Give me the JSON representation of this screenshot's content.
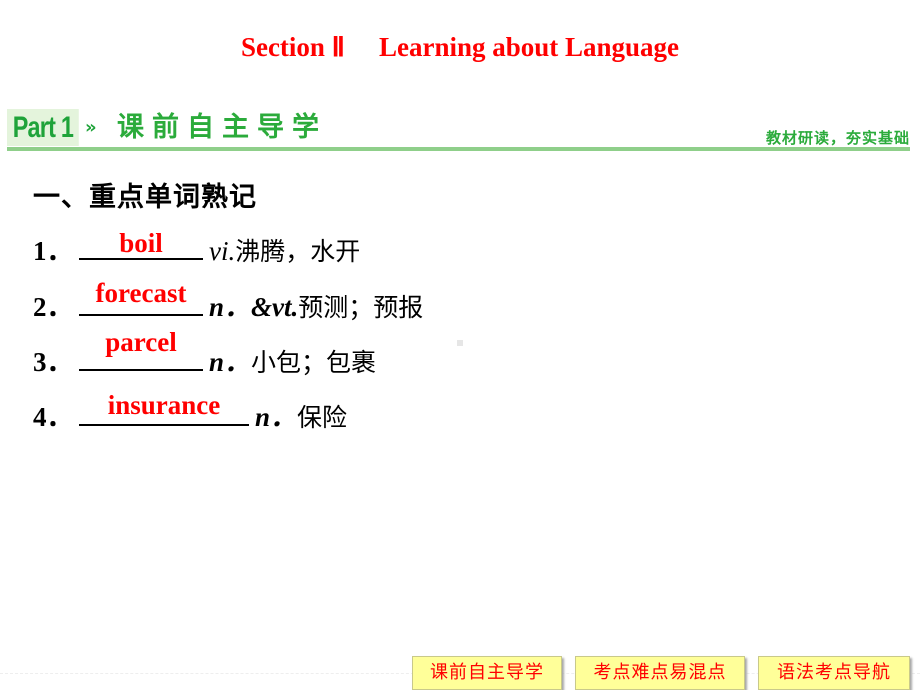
{
  "title": {
    "section": "Section Ⅱ",
    "topic": "Learning about Language"
  },
  "part_header": {
    "badge": "Part 1",
    "arrow": "»",
    "heading": "课前自主导学",
    "subheading": "教材研读，夯实基础"
  },
  "section_heading": "一、重点单词熟记",
  "vocab": [
    {
      "number": "1．",
      "answer": "boil",
      "pos": "vi.",
      "meaning": "沸腾，水开"
    },
    {
      "number": "2．",
      "answer": "forecast",
      "pos": "n．&vt.",
      "meaning": "预测；预报"
    },
    {
      "number": "3．",
      "answer": "parcel",
      "pos": "n．",
      "meaning": "小包；包裹"
    },
    {
      "number": "4．",
      "answer": "insurance",
      "pos": "n．",
      "meaning": "保险"
    }
  ],
  "nav": {
    "buttons": [
      "课前自主导学",
      "考点难点易混点",
      "语法考点导航"
    ]
  },
  "colors": {
    "title": "#ff0000",
    "answer": "#ff0000",
    "accent_green": "#2bab3b",
    "nav_bg": "#ffff99"
  }
}
